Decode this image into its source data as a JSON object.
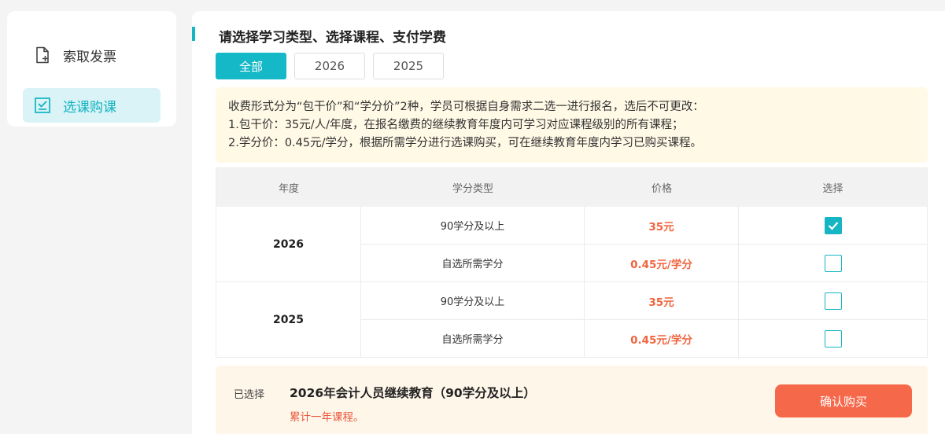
{
  "sidebar": {
    "items": [
      {
        "label": "索取发票",
        "icon": "invoice-add-icon",
        "active": false
      },
      {
        "label": "选课购课",
        "icon": "checklist-icon",
        "active": true
      }
    ]
  },
  "main": {
    "title": "请选择学习类型、选择课程、支付学费",
    "tabs": [
      {
        "label": "全部",
        "active": true
      },
      {
        "label": "2026",
        "active": false
      },
      {
        "label": "2025",
        "active": false
      }
    ],
    "notice": [
      "收费形式分为“包干价”和“学分价”2种，学员可根据自身需求二选一进行报名，选后不可更改：",
      "1.包干价：35元/人/年度，在报名缴费的继续教育年度内可学习对应课程级别的所有课程；",
      "2.学分价：0.45元/学分，根据所需学分进行选课购买，可在继续教育年度内学习已购买课程。"
    ],
    "table": {
      "headers": [
        "年度",
        "学分类型",
        "价格",
        "选择"
      ],
      "groups": [
        {
          "year": "2026",
          "rows": [
            {
              "type": "90学分及以上",
              "price": "35元",
              "checked": true
            },
            {
              "type": "自选所需学分",
              "price": "0.45元/学分",
              "checked": false
            }
          ]
        },
        {
          "year": "2025",
          "rows": [
            {
              "type": "90学分及以上",
              "price": "35元",
              "checked": false
            },
            {
              "type": "自选所需学分",
              "price": "0.45元/学分",
              "checked": false
            }
          ]
        }
      ]
    },
    "selection": {
      "label": "已选择",
      "course": "2026年会计人员继续教育（90学分及以上）",
      "note": "累计一年课程。",
      "confirm_label": "确认购买"
    }
  },
  "colors": {
    "accent": "#14b8c6",
    "price": "#f0643e",
    "confirm": "#f6684a",
    "notice_bg": "#fff9e6"
  }
}
